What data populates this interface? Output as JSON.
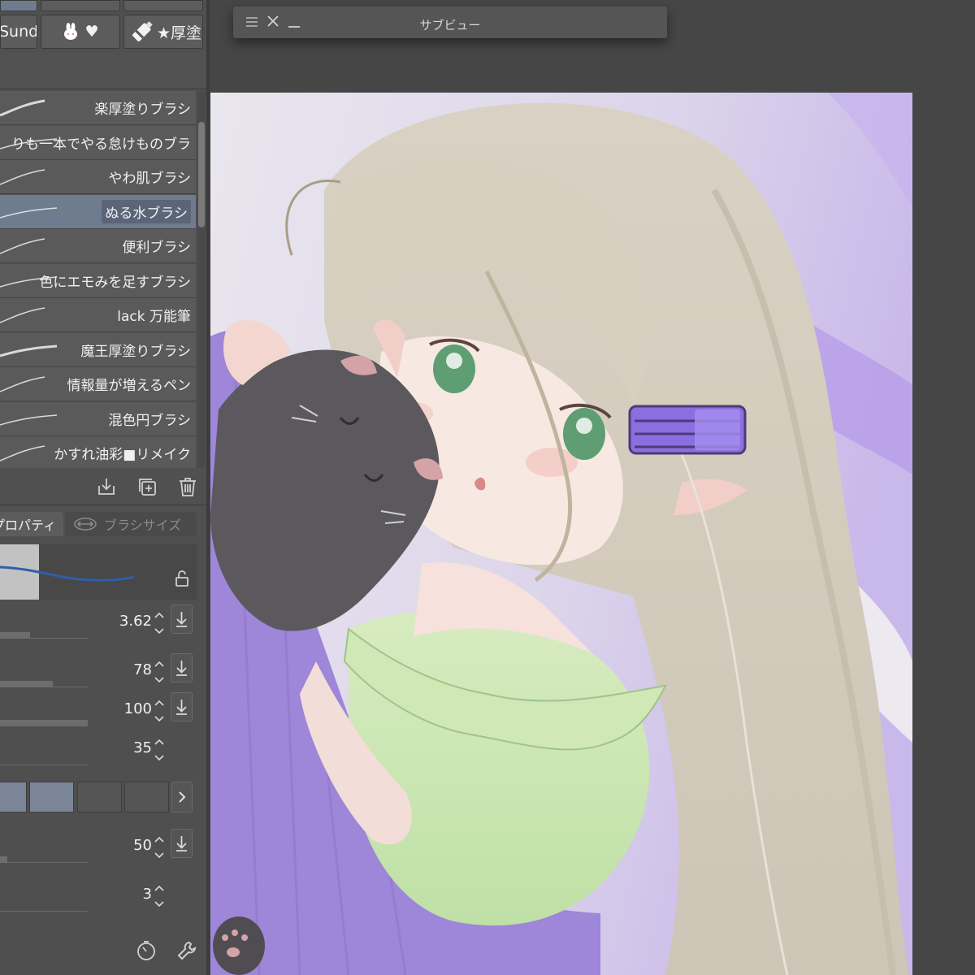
{
  "window": {
    "subview_title": "サブビュー"
  },
  "material_tabs": [
    {
      "label": "Sunda"
    },
    {
      "label": "♥"
    },
    {
      "label": "★厚塗"
    }
  ],
  "brush_list": {
    "items": [
      {
        "label": "楽厚塗りブラシ",
        "selected": false
      },
      {
        "label": "りも一本でやる怠けものブラ",
        "selected": false
      },
      {
        "label": "やわ肌ブラシ",
        "selected": false
      },
      {
        "label": "ぬる水ブラシ",
        "selected": true
      },
      {
        "label": "便利ブラシ",
        "selected": false
      },
      {
        "label": "色にエモみを足すブラシ",
        "selected": false
      },
      {
        "label": "lack 万能筆",
        "selected": false
      },
      {
        "label": "魔王厚塗りブラシ",
        "selected": false
      },
      {
        "label": "情報量が増えるペン",
        "selected": false
      },
      {
        "label": "混色円ブラシ",
        "selected": false
      },
      {
        "label": "かすれ油彩■リメイク",
        "selected": false
      }
    ]
  },
  "property_panel": {
    "tabs": [
      {
        "label": "プロパティ",
        "active": true
      },
      {
        "label": "ブラシサイズ",
        "active": false
      }
    ],
    "rows": [
      {
        "value": "3.62",
        "fill": 0.34
      },
      {
        "value": "78",
        "fill": 0.6
      },
      {
        "value": "100",
        "fill": 1.0
      },
      {
        "value": "35",
        "fill": 0.0
      },
      {
        "value": "50",
        "fill": 0.08
      },
      {
        "value": "3",
        "fill": 0.0
      }
    ]
  },
  "icons": {
    "brush_toolbar": [
      "download-icon",
      "duplicate-icon",
      "trash-icon"
    ],
    "footer": [
      "timer-icon",
      "wrench-icon"
    ]
  },
  "colors": {
    "selection": "#6f7b8f",
    "panel": "#505050",
    "workspace": "#464646",
    "hairclip": "#8b6fe0"
  }
}
